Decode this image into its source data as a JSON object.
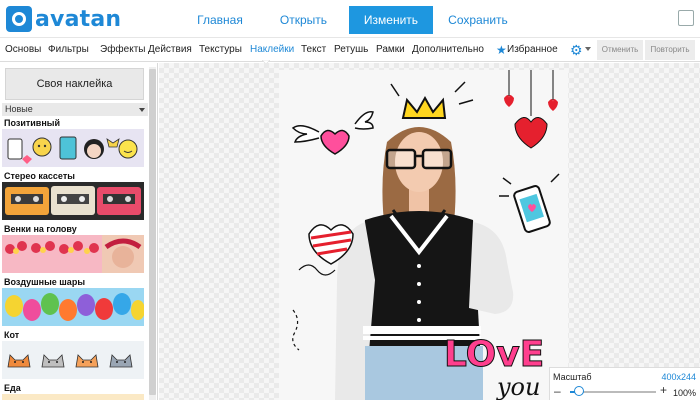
{
  "header": {
    "logo_text": "avatan",
    "nav": [
      "Главная",
      "Открыть",
      "Изменить",
      "Сохранить"
    ],
    "active_nav": "Изменить",
    "accent_color": "#1e88d6"
  },
  "toolbar": {
    "tools": [
      "Основы",
      "Фильтры",
      "Эффекты",
      "Действия",
      "Текстуры",
      "Наклейки",
      "Текст",
      "Ретушь",
      "Рамки",
      "Дополнительно",
      "Избранное"
    ],
    "active_tool": "Наклейки",
    "favorites_icon": "star-icon",
    "settings_icon": "gear-icon",
    "undo_label": "Отменить",
    "redo_label": "Повторить"
  },
  "sidebar": {
    "own_sticker_label": "Своя наклейка",
    "filter_selected": "Новые",
    "categories": [
      "Позитивный",
      "Стерео кассеты",
      "Венки на голову",
      "Воздушные шары",
      "Кот",
      "Еда"
    ]
  },
  "canvas": {
    "stickers": [
      "crown-sticker",
      "glasses-sticker",
      "winged-heart-sticker",
      "hanging-hearts-sticker",
      "phone-sticker",
      "heart-sticker",
      "love-sticker",
      "you-sticker"
    ],
    "love_text": "LOvE",
    "you_text": "you"
  },
  "zoom": {
    "label": "Масштаб",
    "image_size": "400x244",
    "percent": "100%",
    "level": 0.1
  }
}
